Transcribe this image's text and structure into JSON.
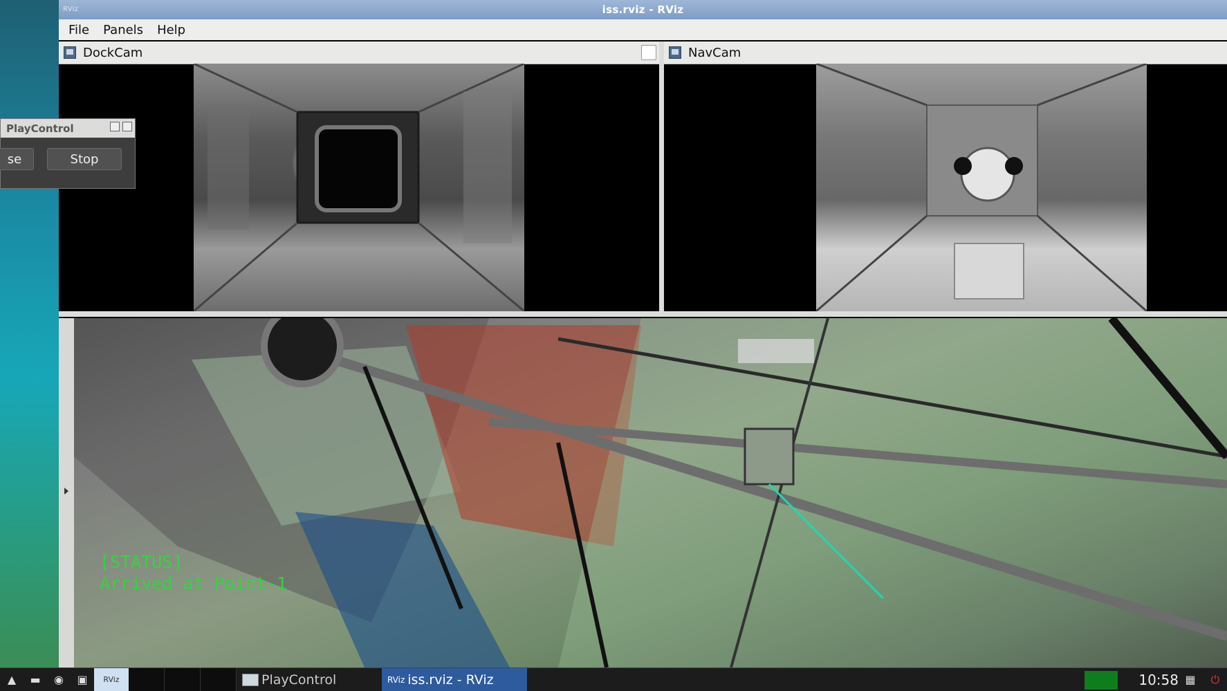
{
  "window": {
    "title": "iss.rviz - RViz",
    "logo": "RViz"
  },
  "menu": {
    "file": "File",
    "panels": "Panels",
    "help": "Help"
  },
  "panels": {
    "dockcam": {
      "title": "DockCam"
    },
    "navcam": {
      "title": "NavCam"
    }
  },
  "status": {
    "line1": "[STATUS]",
    "line2": "Arrived at Point-1"
  },
  "playcontrol": {
    "title": "PlayControl",
    "pause_label": "se",
    "stop_label": "Stop"
  },
  "taskbar": {
    "tasks": [
      {
        "label": "PlayControl",
        "active": false
      },
      {
        "label": "iss.rviz - RViz",
        "active": true
      }
    ],
    "clock": "10:58",
    "rviz_tag": "RViz"
  },
  "colors": {
    "status_text": "#39d043",
    "taskbar_active": "#2e5b9e",
    "title_bar": "#8aa6cc"
  }
}
